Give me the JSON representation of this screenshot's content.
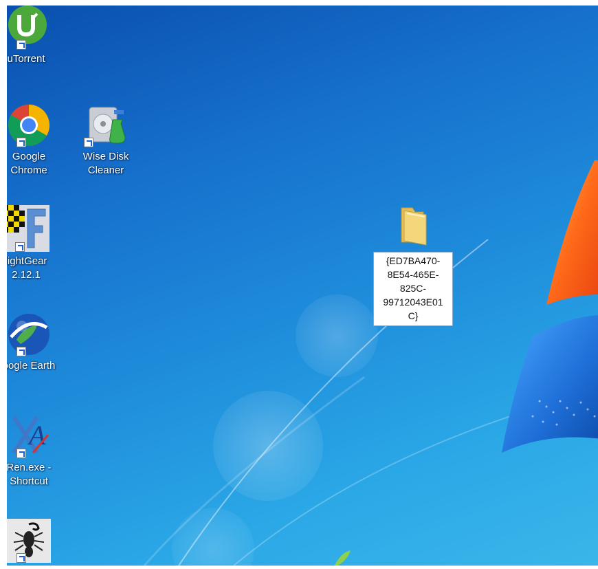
{
  "desktop": {
    "icons": [
      {
        "name": "uTorrent",
        "label": "uTorrent"
      },
      {
        "name": "Google Chrome",
        "label_line1": "Google",
        "label_line2": "Chrome"
      },
      {
        "name": "Wise Disk Cleaner",
        "label_line1": "Wise Disk",
        "label_line2": "Cleaner"
      },
      {
        "name": "FlightGear",
        "label_line1": "lightGear",
        "label_line2": "2.12.1"
      },
      {
        "name": "Google Earth",
        "label": "oogle Earth"
      },
      {
        "name": "XRen",
        "label_line1": "Ren.exe -",
        "label_line2": "Shortcut"
      },
      {
        "name": "scorpion app",
        "label": ""
      }
    ],
    "folder": {
      "name_lines": [
        "{ED7BA470-",
        "8E54-465E-",
        "825C-",
        "99712043E01",
        "C}"
      ]
    }
  },
  "colors": {
    "wallpaper_dark": "#0a4fae",
    "wallpaper_light": "#3bb6ea",
    "logo_orange": "#ff6a1a",
    "logo_blue": "#1e6fd8"
  }
}
